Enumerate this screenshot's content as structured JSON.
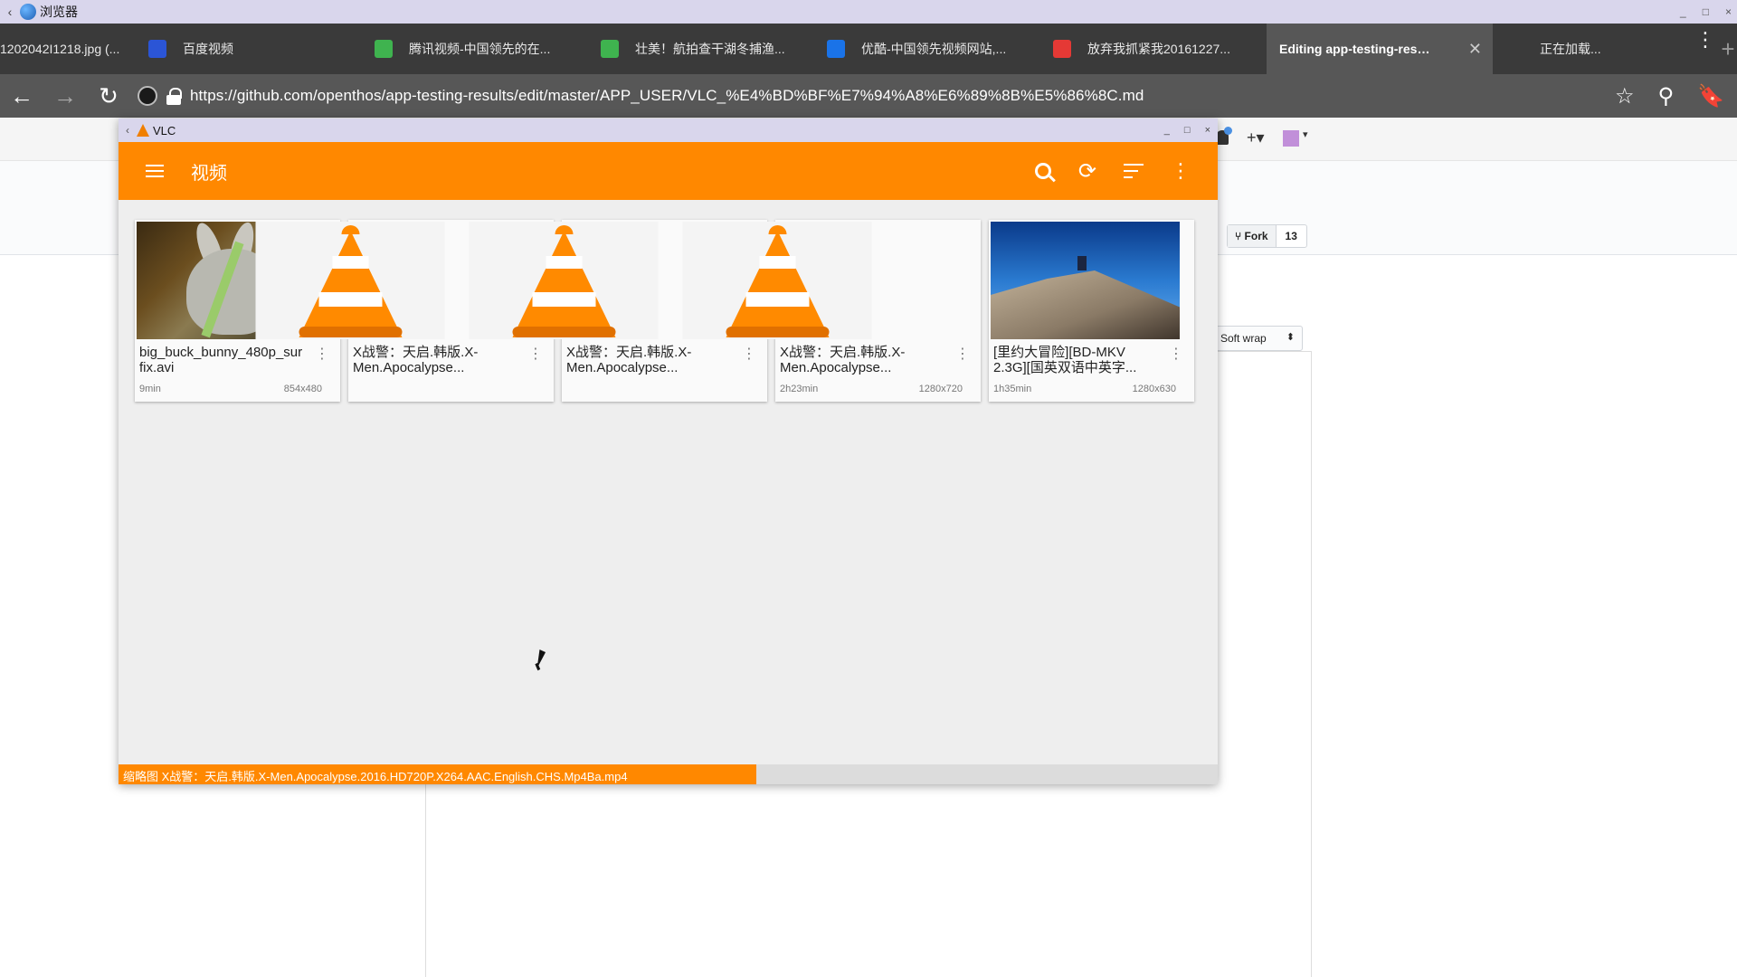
{
  "os": {
    "title": "浏览器",
    "back": "‹",
    "controls": [
      "_",
      "□",
      "×"
    ]
  },
  "tabs": [
    {
      "label": "1202042I1218.jpg (...",
      "icon": "image-icon",
      "color": "#3a3a3a"
    },
    {
      "label": "百度视频",
      "icon": "baidu-paw-icon",
      "color": "#2b55d6"
    },
    {
      "label": "腾讯视频-中国领先的在...",
      "icon": "tencent-video-icon",
      "color": "#3fb34f"
    },
    {
      "label": "壮美！航拍查干湖冬捕渔...",
      "icon": "tencent-video-icon",
      "color": "#3fb34f"
    },
    {
      "label": "优酷-中国领先视频网站,...",
      "icon": "youku-icon",
      "color": "#1a73e8"
    },
    {
      "label": "放弃我抓紧我20161227...",
      "icon": "target-icon",
      "color": "#e53935"
    },
    {
      "label": "Editing app-testing-resul...",
      "icon": "",
      "color": "#575757",
      "active": true
    },
    {
      "label": "正在加载...",
      "icon": "loading-icon",
      "color": "#3a3a3a"
    }
  ],
  "tab_close": "✕",
  "new_tab": "+",
  "browser_menu": "⋮",
  "address": {
    "url": "https://github.com/openthos/app-testing-results/edit/master/APP_USER/VLC_%E4%BD%BF%E7%94%A8%E6%89%8B%E5%86%8C.md",
    "back": "←",
    "forward": "→",
    "reload": "↻",
    "star": "☆",
    "search": "⚲",
    "bookmark": "🔖"
  },
  "github": {
    "plus": "+▾",
    "avatar_caret": "▾",
    "fork_label": "⑂ Fork",
    "fork_count": "13",
    "softwrap_label": "Soft wrap",
    "softwrap_caret": "⬍"
  },
  "vlc": {
    "window_title": "VLC",
    "window_back": "‹",
    "window_controls": [
      "_",
      "□",
      "×"
    ],
    "toolbar_title": "视频",
    "refresh_glyph": "⟳",
    "more_glyph": "⋮",
    "videos": [
      {
        "title": "big_buck_bunny_480p_surround-fix.avi",
        "duration": "9min",
        "resolution": "854x480",
        "thumb": "bunny"
      },
      {
        "title": "X战警：天启.韩版.X-Men.Apocalypse...",
        "duration": "",
        "resolution": "",
        "thumb": "cone"
      },
      {
        "title": "X战警：天启.韩版.X-Men.Apocalypse...",
        "duration": "",
        "resolution": "",
        "thumb": "cone"
      },
      {
        "title": "X战警：天启.韩版.X-Men.Apocalypse...",
        "duration": "2h23min",
        "resolution": "1280x720",
        "thumb": "cone"
      },
      {
        "title": "[里约大冒险][BD-MKV 2.3G][国英双语中英字...",
        "duration": "1h35min",
        "resolution": "1280x630",
        "thumb": "sky"
      }
    ],
    "kebab": "⋮",
    "status_text": "缩略图 X战警：天启.韩版.X-Men.Apocalypse.2016.HD720P.X264.AAC.English.CHS.Mp4Ba.mp4",
    "status_progress": 0.58,
    "accent": "#ff8800"
  }
}
